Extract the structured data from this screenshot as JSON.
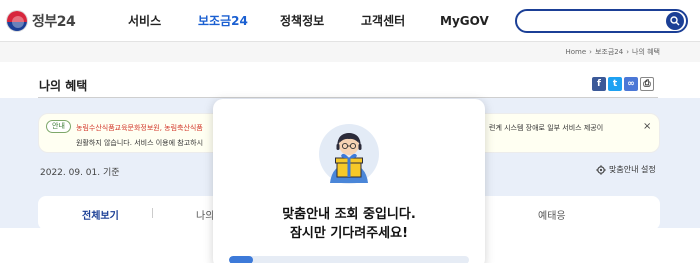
{
  "header": {
    "logo_text": "정부24",
    "nav": [
      {
        "label": "서비스"
      },
      {
        "label": "보조금24"
      },
      {
        "label": "정책정보"
      },
      {
        "label": "고객센터"
      },
      {
        "label": "MyGOV"
      }
    ],
    "search": {
      "value": "",
      "placeholder": ""
    }
  },
  "breadcrumb": [
    "Home",
    "보조금24",
    "나의 혜택"
  ],
  "page": {
    "title": "나의 혜택",
    "share_icons": [
      "facebook-icon",
      "twitter-icon",
      "link-icon",
      "print-icon"
    ]
  },
  "notice": {
    "badge": "안내",
    "text_red": "농림수산식품교육문화정보원, 농림축산식품",
    "text_right": "련계 시스템 장애로 일부 서비스 제공이",
    "text_line2": "원활하지 않습니다. 서비스 이용에 참고하시",
    "close": "×"
  },
  "date_label": "2022. 09. 01. 기준",
  "setting_label": "맞춤안내 설정",
  "tabs": [
    {
      "label": "전체보기"
    },
    {
      "label": "나의"
    },
    {
      "label": "예태응"
    }
  ],
  "modal": {
    "line1": "맞춤안내 조회 중입니다.",
    "line2": "잠시만 기다려주세요!",
    "progress": 0.1
  },
  "colors": {
    "brand_blue": "#1b3f96",
    "active_nav": "#1a5fd1",
    "notice_red": "#d33a2c",
    "progress": "#3d7ad9",
    "area_bg": "#e9eff9"
  }
}
